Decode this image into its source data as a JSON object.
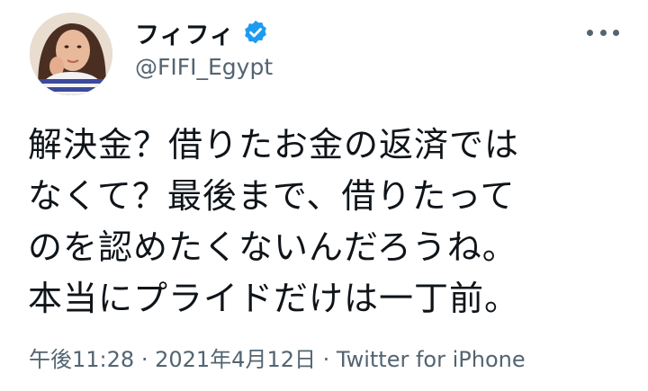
{
  "tweet": {
    "display_name": "フィフィ",
    "handle": "@FIFI_Egypt",
    "verified_icon": "verified-badge-icon",
    "more_icon": "more-options-icon",
    "text_lines": [
      "解決金？借りたお金の返済では",
      "なくて？最後まで、借りたって",
      "のを認めたくないんだろうね。",
      "本当にプライドだけは一丁前。"
    ],
    "time": "午後11:28",
    "separator": "·",
    "date": "2021年4月12日",
    "source": "Twitter for iPhone"
  },
  "colors": {
    "text": "#0f1419",
    "secondary": "#536471",
    "verified": "#1d9bf0",
    "background": "#ffffff"
  }
}
